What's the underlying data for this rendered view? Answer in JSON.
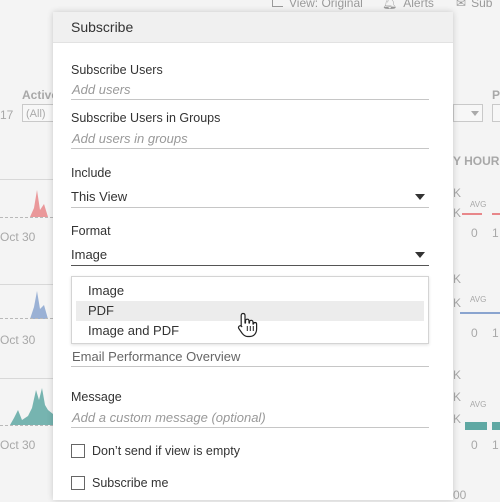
{
  "background": {
    "toolbar": {
      "view_label": "View: Original",
      "alerts_label": "Alerts",
      "subscribe_label": "Sub"
    },
    "left_filter": {
      "label": "Active",
      "value": "(All)",
      "number": "17"
    },
    "right_filter": {
      "label": "P"
    },
    "axis_dates": [
      "Oct 30",
      "Oct 30",
      "Oct 30"
    ],
    "right_header": "Y HOUR",
    "k_labels": [
      "K",
      "K",
      "K",
      "K",
      "K",
      "K",
      "K"
    ],
    "avg_labels": [
      "AVG",
      "AVG",
      "AVG"
    ],
    "right_digits": [
      "0",
      "1",
      "0",
      "1",
      "0",
      "1"
    ],
    "bottom_number": "00"
  },
  "dialog": {
    "title": "Subscribe",
    "subscribe_users": {
      "label": "Subscribe Users",
      "placeholder": "Add users"
    },
    "subscribe_groups": {
      "label": "Subscribe Users in Groups",
      "placeholder": "Add users in groups"
    },
    "include": {
      "label": "Include",
      "value": "This View"
    },
    "format": {
      "label": "Format",
      "value": "Image",
      "options": [
        "Image",
        "PDF",
        "Image and PDF"
      ],
      "hovered_option": "PDF"
    },
    "subject": {
      "value": "Email Performance Overview"
    },
    "message": {
      "label": "Message",
      "placeholder": "Add a custom message (optional)"
    },
    "dont_send_empty": {
      "label": "Don’t send if view is empty",
      "checked": false
    },
    "subscribe_me": {
      "label": "Subscribe me",
      "checked": false
    }
  },
  "colors": {
    "accent_red": "#e8878a",
    "accent_blue": "#8aa4cf",
    "accent_teal": "#5fa8a3"
  },
  "icons": {
    "cursor": "hand-pointer-icon",
    "caret": "caret-down-icon"
  }
}
